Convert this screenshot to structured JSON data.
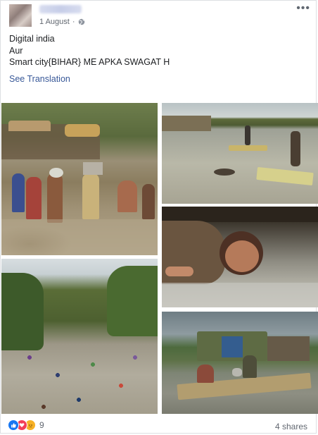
{
  "post": {
    "date": "1 August",
    "privacy_icon": "globe-icon",
    "lines": [
      "Digital india",
      "Aur",
      "Smart city{BIHAR} ME APKA SWAGAT H"
    ],
    "see_translation": "See Translation",
    "more_label": "•••"
  },
  "footer": {
    "reactions": [
      "like-icon",
      "love-icon",
      "sad-icon"
    ],
    "reaction_count": "9",
    "shares": "4 shares"
  },
  "colors": {
    "link": "#385898",
    "meta_text": "#616770",
    "like": "#1877f2",
    "love": "#f33e58",
    "sad": "#f7b125"
  }
}
